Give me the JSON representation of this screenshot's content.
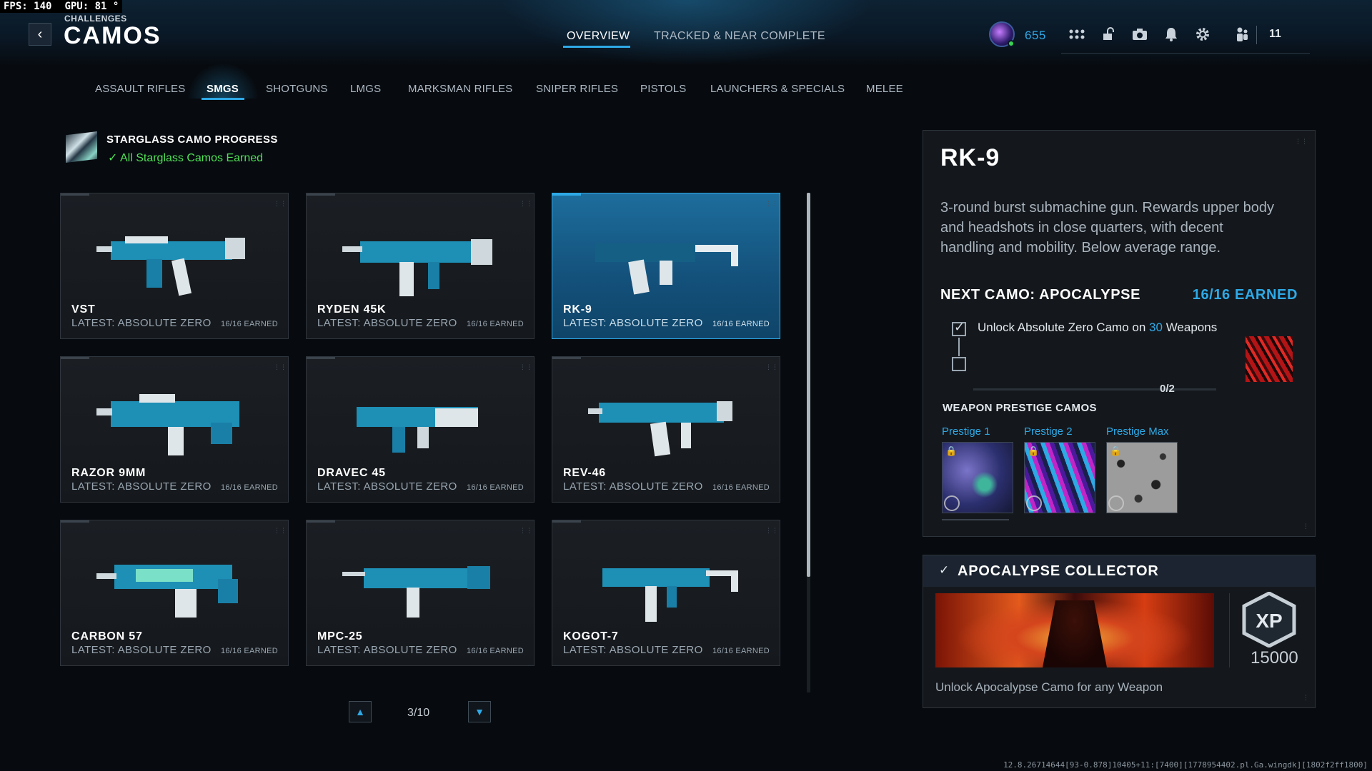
{
  "debug": {
    "fps_label": "FPS:",
    "fps_value": "140",
    "gpu_label": "GPU:",
    "gpu_value": "81 °"
  },
  "header": {
    "breadcrumb": "CHALLENGES",
    "title": "CAMOS",
    "tabs": [
      {
        "label": "OVERVIEW",
        "active": true
      },
      {
        "label": "TRACKED & NEAR COMPLETE",
        "active": false
      }
    ],
    "points": "655",
    "player_count": "11",
    "icons": [
      "apps-grid-icon",
      "unlock-icon",
      "camera-icon",
      "bell-icon",
      "gear-icon",
      "party-icon"
    ]
  },
  "categories": [
    {
      "label": "ASSAULT RIFLES"
    },
    {
      "label": "SMGS",
      "active": true
    },
    {
      "label": "SHOTGUNS"
    },
    {
      "label": "LMGS"
    },
    {
      "label": "MARKSMAN RIFLES"
    },
    {
      "label": "SNIPER RIFLES"
    },
    {
      "label": "PISTOLS"
    },
    {
      "label": "LAUNCHERS & SPECIALS"
    },
    {
      "label": "MELEE"
    }
  ],
  "starglass": {
    "title": "STARGLASS CAMO PROGRESS",
    "status": "All Starglass Camos Earned"
  },
  "weapons": [
    {
      "name": "VST",
      "latest": "LATEST: ABSOLUTE ZERO",
      "earned": "16/16 EARNED"
    },
    {
      "name": "RYDEN 45K",
      "latest": "LATEST: ABSOLUTE ZERO",
      "earned": "16/16 EARNED"
    },
    {
      "name": "RK-9",
      "latest": "LATEST: ABSOLUTE ZERO",
      "earned": "16/16 EARNED",
      "selected": true
    },
    {
      "name": "RAZOR 9MM",
      "latest": "LATEST: ABSOLUTE ZERO",
      "earned": "16/16 EARNED"
    },
    {
      "name": "DRAVEC 45",
      "latest": "LATEST: ABSOLUTE ZERO",
      "earned": "16/16 EARNED"
    },
    {
      "name": "REV-46",
      "latest": "LATEST: ABSOLUTE ZERO",
      "earned": "16/16 EARNED"
    },
    {
      "name": "CARBON 57",
      "latest": "LATEST: ABSOLUTE ZERO",
      "earned": "16/16 EARNED"
    },
    {
      "name": "MPC-25",
      "latest": "LATEST: ABSOLUTE ZERO",
      "earned": "16/16 EARNED"
    },
    {
      "name": "KOGOT-7",
      "latest": "LATEST: ABSOLUTE ZERO",
      "earned": "16/16 EARNED"
    }
  ],
  "pagination": {
    "label": "3/10"
  },
  "detail": {
    "name": "RK-9",
    "description": "3-round burst submachine gun. Rewards upper body and headshots in close quarters, with decent handling and mobility. Below average range.",
    "next_camo": "NEXT CAMO: APOCALYPSE",
    "earned": "16/16 EARNED",
    "challenge_prefix": "Unlock Absolute Zero Camo on",
    "challenge_count": "30",
    "challenge_suffix": "Weapons",
    "challenge_checked": true,
    "progress_text": "0/2",
    "prestige_title": "WEAPON PRESTIGE CAMOS",
    "prestige": [
      {
        "label": "Prestige 1"
      },
      {
        "label": "Prestige 2"
      },
      {
        "label": "Prestige Max"
      }
    ]
  },
  "collector": {
    "title": "APOCALYPSE COLLECTOR",
    "xp_label": "XP",
    "xp_value": "15000",
    "description": "Unlock Apocalypse Camo for any Weapon"
  },
  "build_info": "12.8.26714644[93-0.878]10405+11:[7400][1778954402.pl.Ga.wingdk][1802f2ff1800]",
  "colors": {
    "accent": "#2ea9e6",
    "success": "#50e055",
    "selected_card": "#13507a"
  }
}
